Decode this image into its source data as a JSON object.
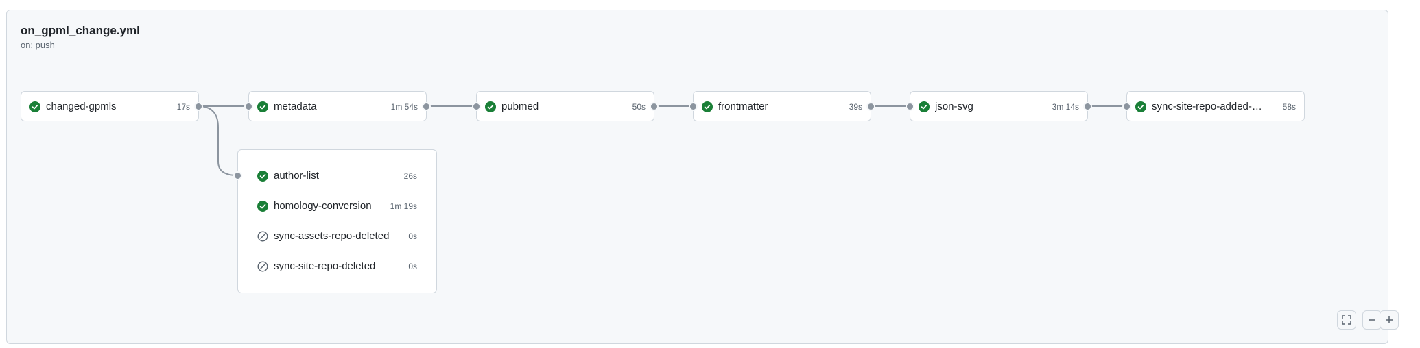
{
  "workflow": {
    "title": "on_gpml_change.yml",
    "trigger": "on: push"
  },
  "jobs": [
    {
      "name": "changed-gpmls",
      "duration": "17s",
      "status": "success"
    },
    {
      "name": "metadata",
      "duration": "1m 54s",
      "status": "success"
    },
    {
      "name": "pubmed",
      "duration": "50s",
      "status": "success"
    },
    {
      "name": "frontmatter",
      "duration": "39s",
      "status": "success"
    },
    {
      "name": "json-svg",
      "duration": "3m 14s",
      "status": "success"
    },
    {
      "name": "sync-site-repo-added-mo...",
      "duration": "58s",
      "status": "success"
    }
  ],
  "group_jobs": [
    {
      "name": "author-list",
      "duration": "26s",
      "status": "success"
    },
    {
      "name": "homology-conversion",
      "duration": "1m 19s",
      "status": "success"
    },
    {
      "name": "sync-assets-repo-deleted",
      "duration": "0s",
      "status": "skipped"
    },
    {
      "name": "sync-site-repo-deleted",
      "duration": "0s",
      "status": "skipped"
    }
  ],
  "controls": {
    "fullscreen_icon": "fullscreen-icon",
    "zoom_out_icon": "minus-icon",
    "zoom_in_icon": "plus-icon"
  },
  "colors": {
    "success": "#1a7f37",
    "skipped": "#59636e",
    "connector": "#8c959f"
  }
}
